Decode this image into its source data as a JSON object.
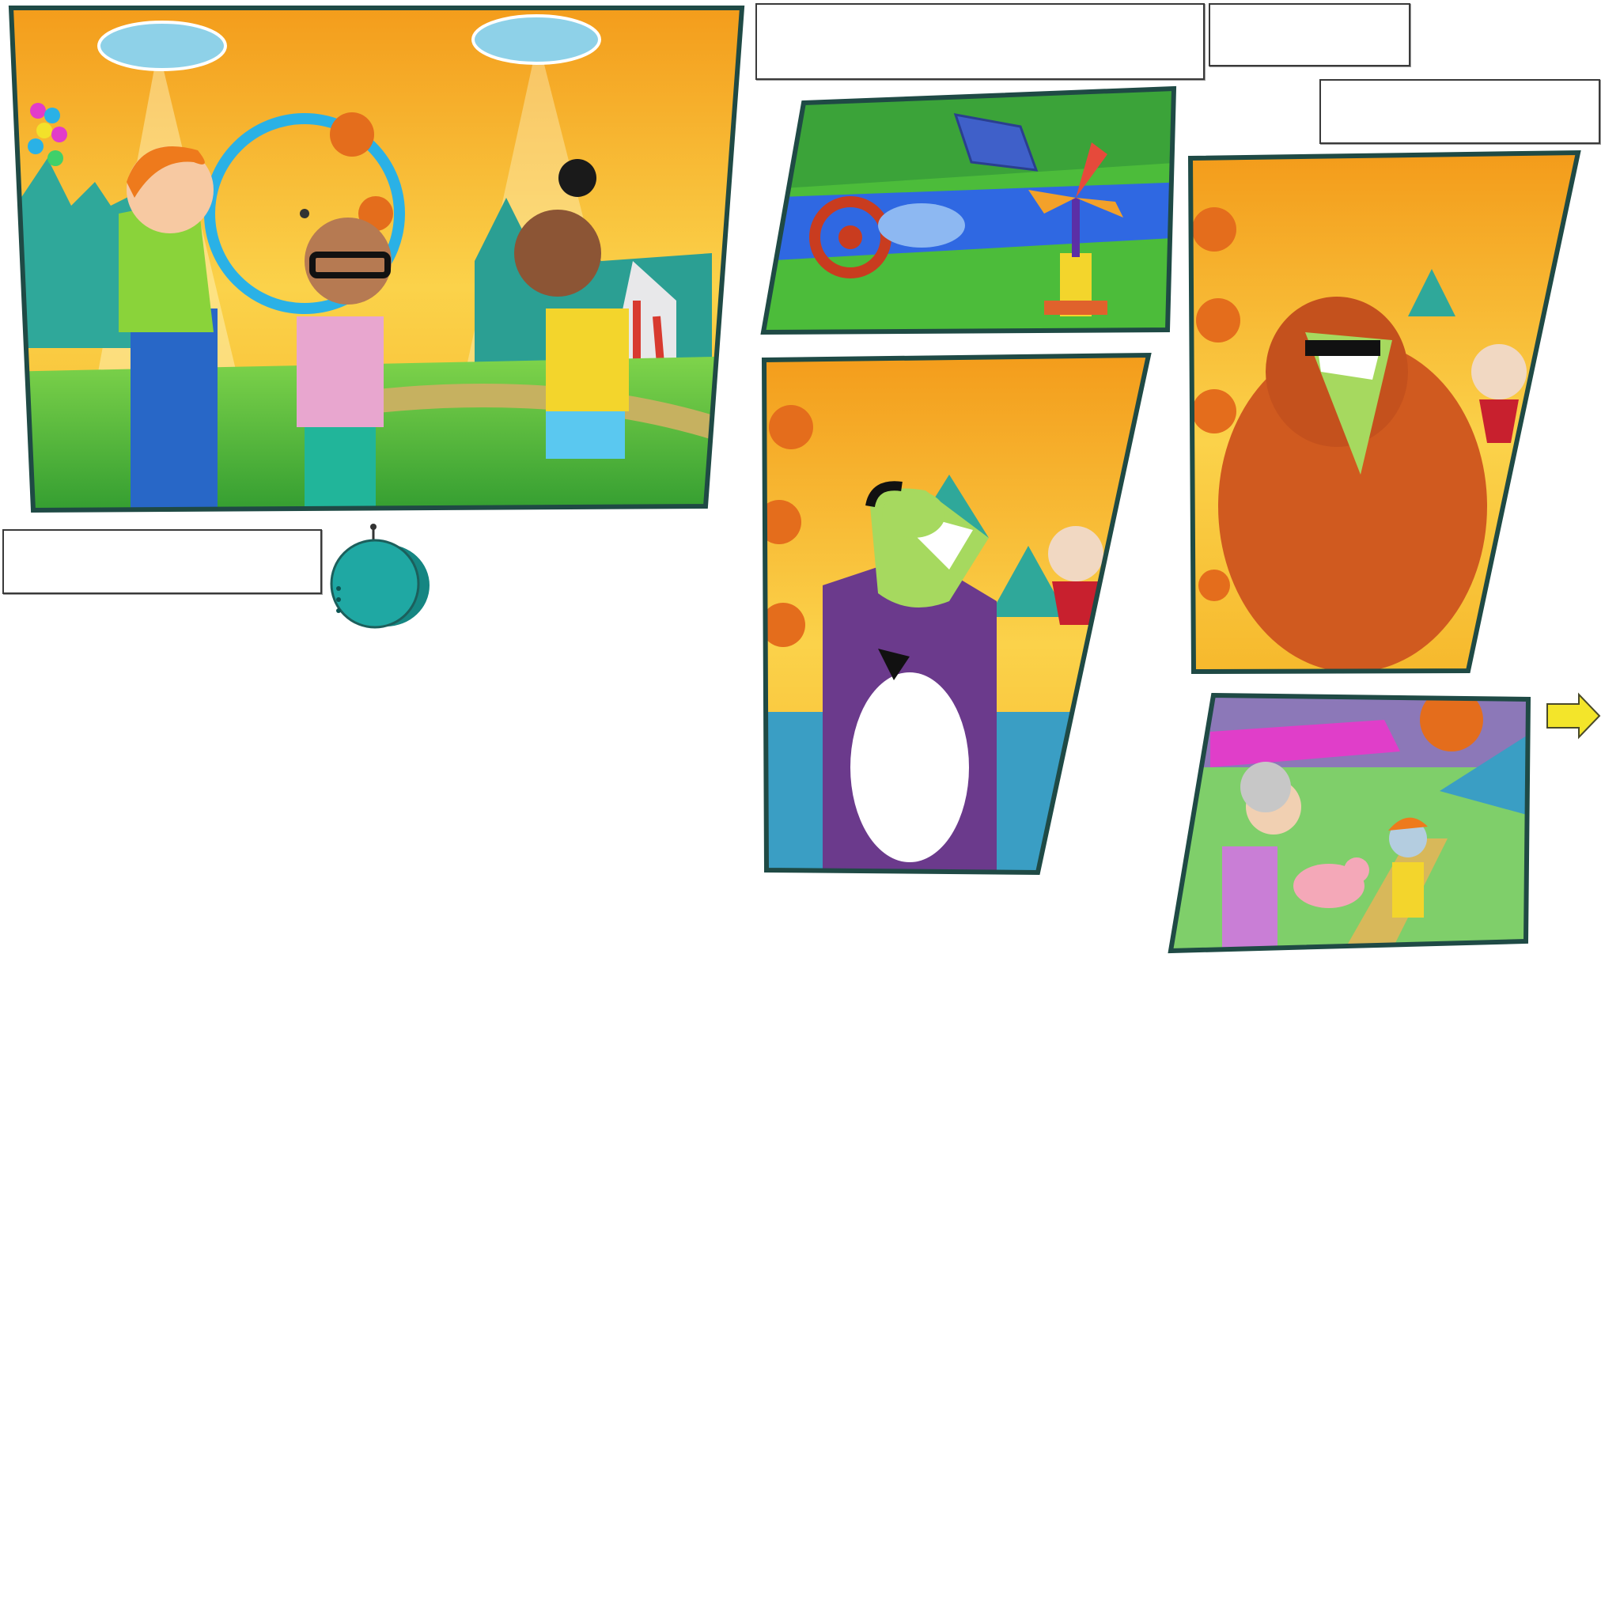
{
  "comic": {
    "captions": {
      "panel1_caption": "",
      "top_center_caption": "",
      "top_right_caption": "",
      "right_caption": ""
    },
    "colors": {
      "panel_border": "#1f4a45",
      "sky_orange": "#f6a21e",
      "sky_yellow": "#fbd34a",
      "grass_green": "#5bbf3a",
      "river_blue": "#2f6fe0",
      "robot_teal": "#1fa8a3",
      "next_arrow": "#f3e52a"
    },
    "icons": {
      "next": "arrow-right-icon",
      "robot": "robot-ball-icon"
    }
  }
}
